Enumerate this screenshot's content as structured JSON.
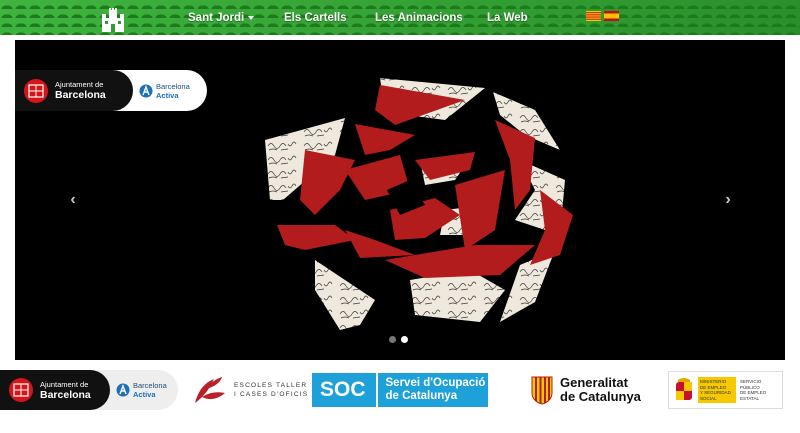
{
  "nav": {
    "items": [
      {
        "label": "Sant Jordi",
        "has_dropdown": true
      },
      {
        "label": "Els Cartells"
      },
      {
        "label": "Les Animacions"
      },
      {
        "label": "La Web"
      }
    ],
    "languages": [
      "ca",
      "es"
    ]
  },
  "carousel": {
    "prev_symbol": "‹",
    "next_symbol": "›",
    "slide_count": 2,
    "active_slide": 2,
    "sponsor": {
      "city_line1": "Ajuntament de",
      "city_line2": "Barcelona",
      "activa_line1": "Barcelona",
      "activa_line2": "Activa"
    }
  },
  "footer": {
    "ajuntament_line1": "Ajuntament de",
    "ajuntament_line2": "Barcelona",
    "activa_line1": "Barcelona",
    "activa_line2": "Activa",
    "escoles_line1": "ESCOLES TALLER",
    "escoles_line2": "I CASES D'OFICIS",
    "soc_short": "SOC",
    "soc_line1": "Servei d'Ocupació",
    "soc_line2": "de Catalunya",
    "gen_line1": "Generalitat",
    "gen_line2": "de Catalunya",
    "ministerio_line1": "MINISTERIO",
    "ministerio_line2": "DE EMPLEO",
    "ministerio_line3": "Y SEGURIDAD SOCIAL",
    "sepe_line1": "SERVICIO PÚBLICO",
    "sepe_line2": "DE EMPLEO ESTATAL"
  },
  "colors": {
    "nav_green": "#2f9e2f",
    "rose_red": "#b21c1c",
    "soc_blue": "#1ea0d8"
  }
}
